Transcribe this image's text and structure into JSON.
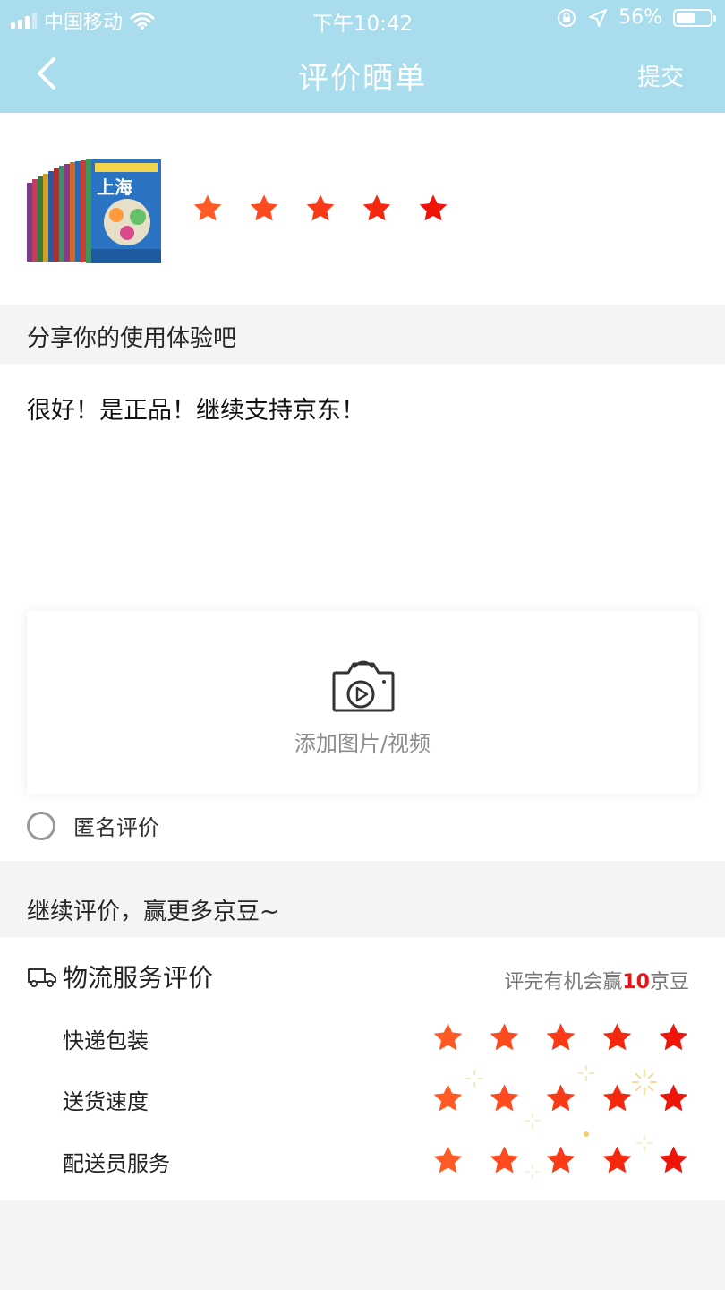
{
  "status_bar": {
    "carrier": "中国移动",
    "time": "下午10:42",
    "battery": "56%",
    "battery_level": 0.56
  },
  "nav": {
    "title": "评价晒单",
    "submit": "提交"
  },
  "product": {
    "cover_text": "上海",
    "rating": 5,
    "star_colors": [
      "#ff5a26",
      "#fd4b1f",
      "#f83a17",
      "#f3280f",
      "#ee1409"
    ]
  },
  "review": {
    "section_title": "分享你的使用体验吧",
    "text": "很好！是正品！继续支持京东！",
    "upload_label": "添加图片/视频",
    "anonymous_label": "匿名评价",
    "anonymous_checked": false
  },
  "more": {
    "section_title": "继续评价，赢更多京豆~"
  },
  "logistics": {
    "title": "物流服务评价",
    "note_prefix": "评完有机会赢",
    "note_amount": "10",
    "note_suffix": "京豆",
    "items": [
      {
        "label": "快递包装",
        "rating": 5
      },
      {
        "label": "送货速度",
        "rating": 5
      },
      {
        "label": "配送员服务",
        "rating": 5
      }
    ]
  },
  "colors": {
    "header_bg": "#a9dcec",
    "accent_red": "#e4161a"
  }
}
